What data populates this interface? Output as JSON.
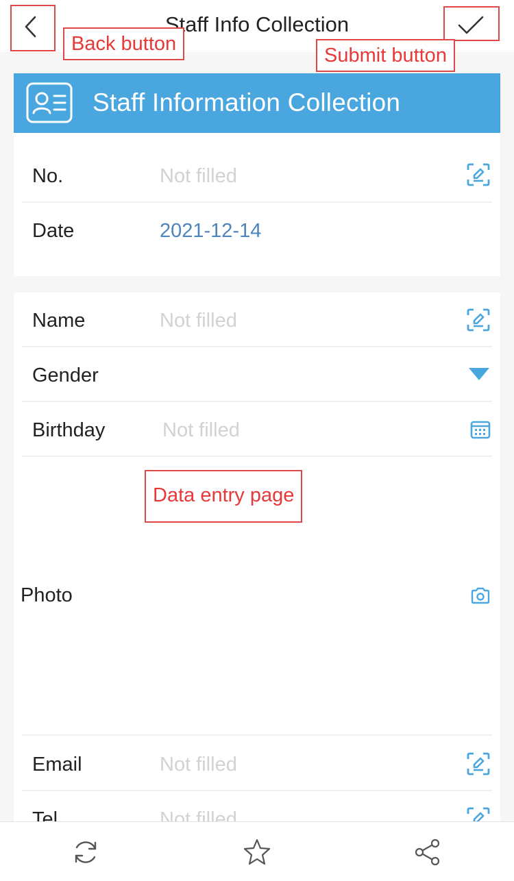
{
  "header": {
    "title": "Staff Info Collection",
    "back_icon": "chevron-left-icon",
    "submit_icon": "checkmark-icon"
  },
  "form": {
    "banner_title": "Staff Information Collection",
    "banner_icon": "id-card-icon",
    "banner_color": "#4aa6df",
    "fields": [
      {
        "label": "No.",
        "value": "Not filled",
        "icon": "scan-edit-icon"
      },
      {
        "label": "Date",
        "value": "2021-12-14"
      },
      {
        "label": "Name",
        "value": "Not filled",
        "icon": "scan-edit-icon"
      },
      {
        "label": "Gender",
        "value": "",
        "icon": "dropdown-triangle-icon"
      },
      {
        "label": "Birthday",
        "value": "Not filled",
        "icon": "calendar-icon"
      },
      {
        "label": "Photo",
        "value": "",
        "icon": "camera-icon"
      },
      {
        "label": "Email",
        "value": "Not filled",
        "icon": "scan-edit-icon"
      },
      {
        "label": "Tel",
        "value": "Not filled",
        "icon": "scan-edit-icon"
      }
    ]
  },
  "annotations": {
    "back": "Back button",
    "submit": "Submit button",
    "data_entry": "Data entry page",
    "color": "#e04848"
  },
  "bottombar": {
    "icons": [
      "refresh-icon",
      "star-icon",
      "share-icon"
    ]
  },
  "colors": {
    "accent": "#4aa6df",
    "placeholder": "#d2d2d2",
    "date_value": "#4f84bd"
  }
}
